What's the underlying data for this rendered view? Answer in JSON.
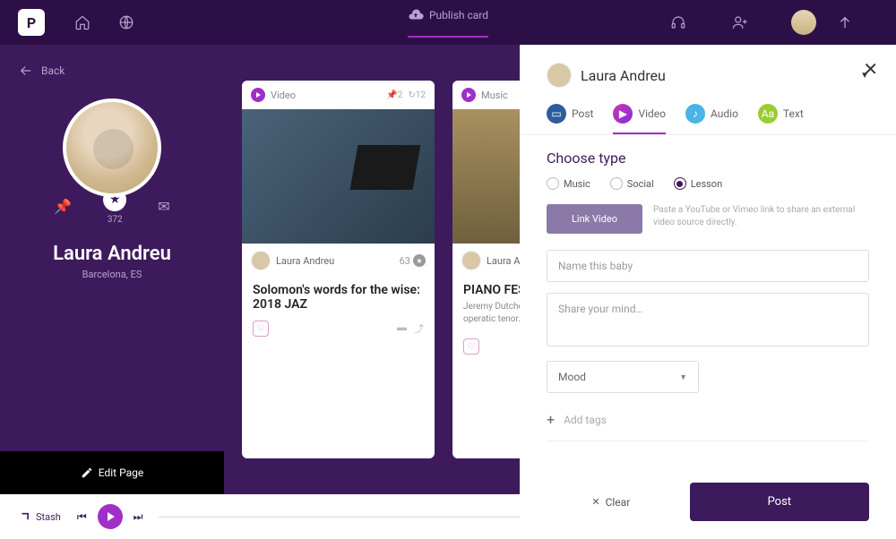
{
  "top": {
    "publish": "Publish card",
    "back": "Back"
  },
  "profile": {
    "name": "Laura Andreu",
    "location": "Barcelona, ES",
    "stars": "372",
    "edit": "Edit Page"
  },
  "cards": [
    {
      "type": "Video",
      "stat1": "2",
      "stat2": "12",
      "author": "Laura Andreu",
      "score": "63",
      "title": "Solomon's words for the wise: 2018 JAZ"
    },
    {
      "type": "Music",
      "author": "Laura A",
      "title": "PIANO FEST //",
      "desc": "Jeremy Dutcher is composer, activist, operatic tenor."
    }
  ],
  "panel": {
    "user": "Laura Andreu",
    "tabs": {
      "post": "Post",
      "video": "Video",
      "audio": "Audio",
      "text": "Text"
    },
    "choose": "Choose type",
    "opts": {
      "music": "Music",
      "social": "Social",
      "lesson": "Lesson"
    },
    "link_btn": "Link Video",
    "link_hint": "Paste a YouTube or Vimeo link to share an external video source directly.",
    "name_ph": "Name this baby",
    "mind_ph": "Share your mind…",
    "mood": "Mood",
    "addtags": "Add tags",
    "clear": "Clear",
    "post": "Post"
  },
  "player": {
    "stash": "Stash"
  }
}
